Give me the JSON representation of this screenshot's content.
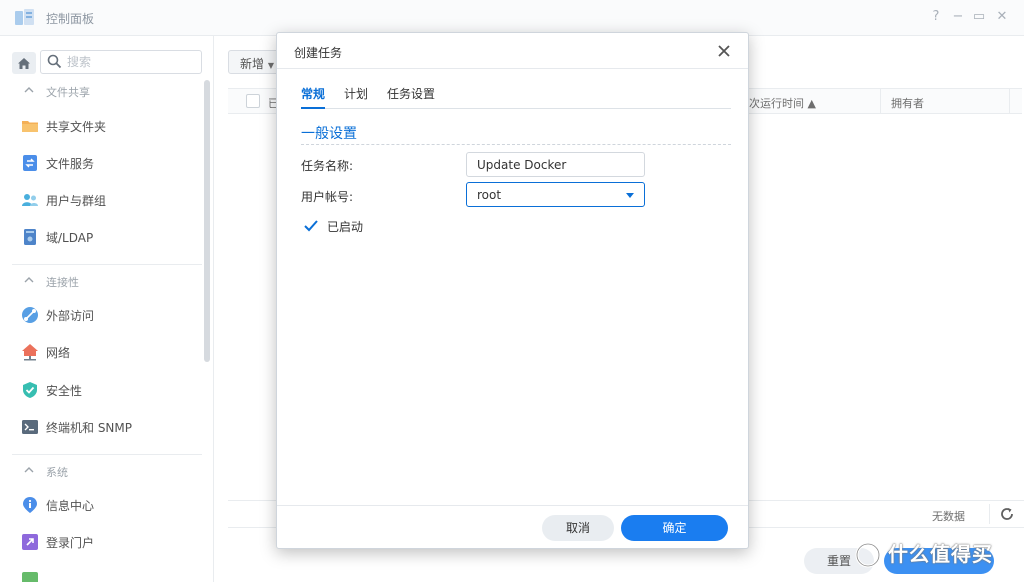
{
  "window": {
    "title": "控制面板",
    "help": "?",
    "minimize": "−",
    "maximize": "▭",
    "close": "✕"
  },
  "sidebar": {
    "search_placeholder": "搜索",
    "groups": [
      {
        "label": "文件共享",
        "items": [
          {
            "label": "共享文件夹",
            "icon": "shared-folder-icon"
          },
          {
            "label": "文件服务",
            "icon": "file-services-icon"
          },
          {
            "label": "用户与群组",
            "icon": "user-group-icon"
          },
          {
            "label": "域/LDAP",
            "icon": "domain-ldap-icon"
          }
        ]
      },
      {
        "label": "连接性",
        "items": [
          {
            "label": "外部访问",
            "icon": "external-access-icon"
          },
          {
            "label": "网络",
            "icon": "network-icon"
          },
          {
            "label": "安全性",
            "icon": "security-shield-icon"
          },
          {
            "label": "终端机和 SNMP",
            "icon": "terminal-icon"
          }
        ]
      },
      {
        "label": "系统",
        "items": [
          {
            "label": "信息中心",
            "icon": "info-center-icon"
          },
          {
            "label": "登录门户",
            "icon": "login-portal-icon"
          }
        ]
      }
    ]
  },
  "main": {
    "add_button": "新增",
    "columns": [
      "已",
      "下次运行时间 ▲",
      "拥有者"
    ],
    "no_data": "无数据",
    "reset_button": "重置"
  },
  "watermark": "什么值得买",
  "modal": {
    "title": "创建任务",
    "tabs": [
      "常规",
      "计划",
      "任务设置"
    ],
    "section_title": "一般设置",
    "task_name_label": "任务名称:",
    "task_name_value": "Update Docker",
    "user_account_label": "用户帐号:",
    "user_account_value": "root",
    "enabled_label": "已启动",
    "enabled_checked": true,
    "cancel_button": "取消",
    "ok_button": "确定"
  },
  "colors": {
    "accent": "#0a6fd7",
    "primary_button": "#1a7df0",
    "secondary_button": "#e9edf1"
  }
}
